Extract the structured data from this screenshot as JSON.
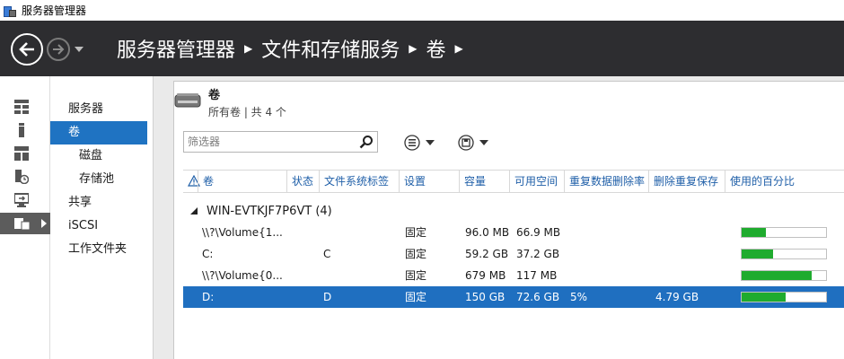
{
  "window": {
    "title": "服务器管理器"
  },
  "header": {
    "breadcrumb": [
      "服务器管理器",
      "文件和存储服务",
      "卷"
    ]
  },
  "rail": {
    "items": [
      {
        "icon": "dashboard-icon"
      },
      {
        "icon": "local-server-icon"
      },
      {
        "icon": "all-servers-icon"
      },
      {
        "icon": "file-services-icon"
      },
      {
        "icon": "remote-desktop-icon"
      },
      {
        "icon": "file-storage-icon",
        "active": true
      }
    ]
  },
  "nav": {
    "items": [
      {
        "label": "服务器",
        "level": 0,
        "active": false
      },
      {
        "label": "卷",
        "level": 0,
        "active": true
      },
      {
        "label": "磁盘",
        "level": 1,
        "active": false
      },
      {
        "label": "存储池",
        "level": 1,
        "active": false
      },
      {
        "label": "共享",
        "level": 0,
        "active": false
      },
      {
        "label": "iSCSI",
        "level": 0,
        "active": false
      },
      {
        "label": "工作文件夹",
        "level": 0,
        "active": false
      }
    ]
  },
  "panel": {
    "title": "卷",
    "subtitle": "所有卷 | 共 4 个",
    "filter_placeholder": "筛选器"
  },
  "table": {
    "columns": [
      "卷",
      "状态",
      "文件系统标签",
      "设置",
      "容量",
      "可用空间",
      "重复数据删除率",
      "删除重复保存",
      "使用的百分比"
    ],
    "group_label": "WIN-EVTKJF7P6VT (4)",
    "rows": [
      {
        "volume": "\\\\?\\Volume{1...",
        "status": "",
        "label": "",
        "provisioning": "固定",
        "capacity": "96.0 MB",
        "free": "66.9 MB",
        "dedup_rate": "",
        "dedup_saved": "",
        "percent_used": 29,
        "selected": false
      },
      {
        "volume": "C:",
        "status": "",
        "label": "C",
        "provisioning": "固定",
        "capacity": "59.2 GB",
        "free": "37.2 GB",
        "dedup_rate": "",
        "dedup_saved": "",
        "percent_used": 37,
        "selected": false
      },
      {
        "volume": "\\\\?\\Volume{0...",
        "status": "",
        "label": "",
        "provisioning": "固定",
        "capacity": "679 MB",
        "free": "117 MB",
        "dedup_rate": "",
        "dedup_saved": "",
        "percent_used": 83,
        "selected": false
      },
      {
        "volume": "D:",
        "status": "",
        "label": "D",
        "provisioning": "固定",
        "capacity": "150 GB",
        "free": "72.6 GB",
        "dedup_rate": "5%",
        "dedup_saved": "4.79 GB",
        "percent_used": 52,
        "selected": true
      }
    ]
  },
  "colors": {
    "header_bg": "#2d2d30",
    "accent": "#1f73c2",
    "selected_row": "#1f6fc0",
    "bar_fill": "#1fab2e",
    "column_header_text": "#1f5fa8"
  }
}
